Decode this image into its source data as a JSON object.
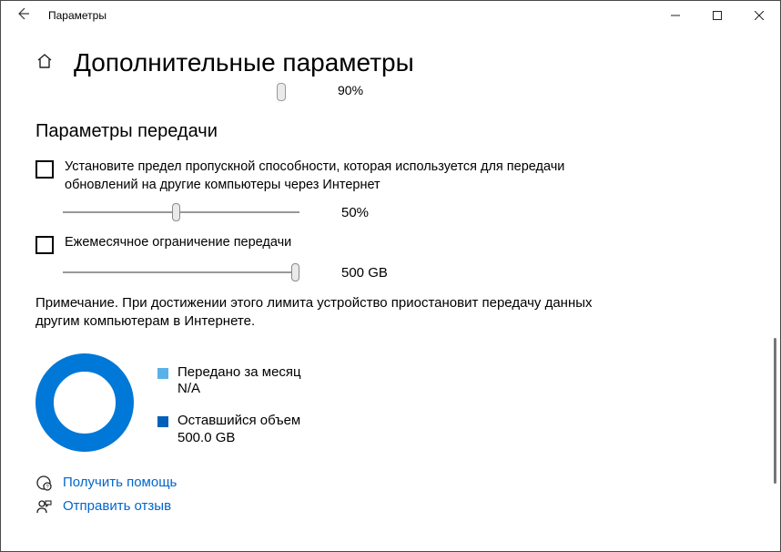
{
  "titlebar": {
    "app": "Параметры"
  },
  "page": {
    "title": "Дополнительные параметры"
  },
  "prev_slider": {
    "value": "90%"
  },
  "section": {
    "title": "Параметры передачи",
    "opt1": "Установите предел пропускной способности, которая используется для передачи обновлений на другие компьютеры через Интернет",
    "slider1_val": "50%",
    "opt2": "Ежемесячное ограничение передачи",
    "slider2_val": "500 GB",
    "note": "Примечание. При достижении этого лимита устройство приостановит передачу данных другим компьютерам в Интернете."
  },
  "legend": {
    "uploaded_label": "Передано за месяц",
    "uploaded_val": "N/A",
    "remaining_label": "Оставшийся объем",
    "remaining_val": "500.0 GB"
  },
  "links": {
    "help": "Получить помощь",
    "feedback": "Отправить отзыв"
  }
}
